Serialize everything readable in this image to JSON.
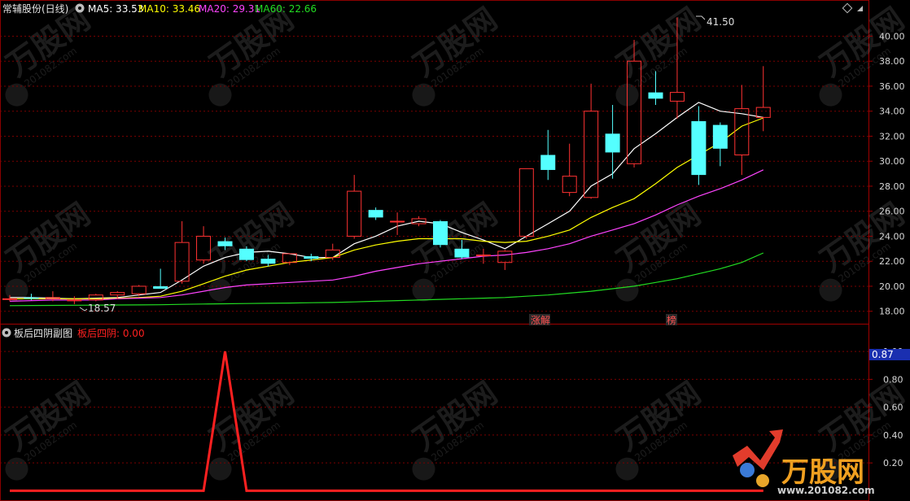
{
  "main_panel": {
    "title": "常辅股份(日线)",
    "ma_labels": [
      {
        "text": "MA5: 33.53",
        "color": "#ffffff"
      },
      {
        "text": "MA10: 33.46",
        "color": "#ffff00"
      },
      {
        "text": "MA20: 29.31",
        "color": "#ff44ff"
      },
      {
        "text": "MA60: 22.66",
        "color": "#22dd22"
      }
    ],
    "annotations": {
      "high": "41.50",
      "low": "18.57"
    },
    "markers": [
      "涨解",
      "榜"
    ],
    "gear_icon": "gear-icon",
    "diamond_icon": "diamond-icon"
  },
  "sub_panel": {
    "title": "板后四阴副图",
    "indicator_label": "板后四阴: 0.00",
    "indicator_color": "#ff2020",
    "current_value_badge": "0.87"
  },
  "watermark": {
    "brand": "万股网",
    "site": "www.201082.com"
  },
  "chart_data": [
    {
      "type": "candlestick",
      "title": "常辅股份(日线)",
      "y_ticks": [
        18.0,
        20.0,
        22.0,
        24.0,
        26.0,
        28.0,
        30.0,
        32.0,
        34.0,
        36.0,
        38.0,
        40.0
      ],
      "ylim": [
        17.2,
        42.5
      ],
      "candles": [
        {
          "o": 19.0,
          "h": 19.3,
          "l": 18.8,
          "c": 19.0
        },
        {
          "o": 19.1,
          "h": 19.4,
          "l": 18.9,
          "c": 19.0
        },
        {
          "o": 19.0,
          "h": 19.6,
          "l": 18.8,
          "c": 19.1
        },
        {
          "o": 18.9,
          "h": 19.2,
          "l": 18.57,
          "c": 18.9
        },
        {
          "o": 18.9,
          "h": 19.4,
          "l": 18.8,
          "c": 19.3
        },
        {
          "o": 19.3,
          "h": 19.6,
          "l": 19.0,
          "c": 19.5
        },
        {
          "o": 19.4,
          "h": 20.1,
          "l": 19.2,
          "c": 20.0
        },
        {
          "o": 20.0,
          "h": 21.4,
          "l": 19.8,
          "c": 19.8
        },
        {
          "o": 20.4,
          "h": 25.2,
          "l": 20.2,
          "c": 23.5
        },
        {
          "o": 22.1,
          "h": 24.8,
          "l": 21.8,
          "c": 24.0
        },
        {
          "o": 23.6,
          "h": 23.9,
          "l": 22.9,
          "c": 23.2
        },
        {
          "o": 23.0,
          "h": 23.2,
          "l": 22.0,
          "c": 22.1
        },
        {
          "o": 22.2,
          "h": 22.5,
          "l": 21.6,
          "c": 21.8
        },
        {
          "o": 21.9,
          "h": 22.6,
          "l": 21.7,
          "c": 22.6
        },
        {
          "o": 22.4,
          "h": 22.6,
          "l": 22.0,
          "c": 22.2
        },
        {
          "o": 22.3,
          "h": 23.4,
          "l": 22.1,
          "c": 22.9
        },
        {
          "o": 24.0,
          "h": 28.9,
          "l": 23.8,
          "c": 27.6
        },
        {
          "o": 26.1,
          "h": 26.3,
          "l": 25.3,
          "c": 25.5
        },
        {
          "o": 25.2,
          "h": 25.9,
          "l": 24.1,
          "c": 25.2
        },
        {
          "o": 25.0,
          "h": 25.6,
          "l": 24.8,
          "c": 25.4
        },
        {
          "o": 25.2,
          "h": 25.3,
          "l": 23.1,
          "c": 23.3
        },
        {
          "o": 23.0,
          "h": 23.7,
          "l": 22.2,
          "c": 22.3
        },
        {
          "o": 22.5,
          "h": 23.0,
          "l": 21.8,
          "c": 22.5
        },
        {
          "o": 21.9,
          "h": 22.9,
          "l": 21.3,
          "c": 22.8
        },
        {
          "o": 24.0,
          "h": 29.4,
          "l": 23.8,
          "c": 29.4
        },
        {
          "o": 30.5,
          "h": 32.5,
          "l": 28.5,
          "c": 29.3
        },
        {
          "o": 27.5,
          "h": 31.4,
          "l": 27.2,
          "c": 28.8
        },
        {
          "o": 27.1,
          "h": 36.2,
          "l": 27.0,
          "c": 34.0
        },
        {
          "o": 32.2,
          "h": 34.5,
          "l": 28.6,
          "c": 30.7
        },
        {
          "o": 29.8,
          "h": 39.7,
          "l": 29.5,
          "c": 38.0
        },
        {
          "o": 35.5,
          "h": 37.2,
          "l": 34.5,
          "c": 35.0
        },
        {
          "o": 34.8,
          "h": 41.5,
          "l": 33.4,
          "c": 35.5
        },
        {
          "o": 33.2,
          "h": 34.4,
          "l": 28.1,
          "c": 28.9
        },
        {
          "o": 32.9,
          "h": 33.1,
          "l": 29.6,
          "c": 31.0
        },
        {
          "o": 30.5,
          "h": 36.1,
          "l": 28.9,
          "c": 34.2
        },
        {
          "o": 33.5,
          "h": 37.6,
          "l": 32.4,
          "c": 34.3
        }
      ],
      "ma_series": [
        {
          "name": "MA5",
          "color": "#ffffff",
          "start": 0,
          "values": [
            19.1,
            19.1,
            19.05,
            19.0,
            19.05,
            19.1,
            19.3,
            19.5,
            20.5,
            21.6,
            22.3,
            22.7,
            22.8,
            22.6,
            22.3,
            22.3,
            23.4,
            24.0,
            24.8,
            25.2,
            25.0,
            24.3,
            23.7,
            23.0,
            24.0,
            25.0,
            26.0,
            28.0,
            29.0,
            31.0,
            32.2,
            33.5,
            34.7,
            34.0,
            33.8,
            33.5
          ]
        },
        {
          "name": "MA10",
          "color": "#ffff00",
          "start": 0,
          "values": [
            19.0,
            19.0,
            19.0,
            19.0,
            19.0,
            19.05,
            19.1,
            19.2,
            19.6,
            20.2,
            20.8,
            21.3,
            21.6,
            21.9,
            22.1,
            22.3,
            22.9,
            23.3,
            23.6,
            23.8,
            23.8,
            23.8,
            23.6,
            23.5,
            23.6,
            24.0,
            24.5,
            25.5,
            26.3,
            27.0,
            28.2,
            29.5,
            30.5,
            31.5,
            32.8,
            33.46
          ]
        },
        {
          "name": "MA20",
          "color": "#ff44ff",
          "start": 0,
          "values": [
            18.8,
            18.85,
            18.9,
            18.9,
            18.9,
            19.0,
            19.05,
            19.1,
            19.3,
            19.6,
            19.9,
            20.1,
            20.2,
            20.3,
            20.4,
            20.5,
            20.8,
            21.2,
            21.5,
            21.8,
            22.0,
            22.2,
            22.4,
            22.5,
            22.7,
            23.0,
            23.4,
            24.0,
            24.5,
            25.0,
            25.7,
            26.5,
            27.2,
            27.8,
            28.5,
            29.31
          ]
        },
        {
          "name": "MA60",
          "color": "#22dd22",
          "start": 0,
          "values": [
            18.45,
            18.46,
            18.47,
            18.48,
            18.49,
            18.5,
            18.51,
            18.52,
            18.55,
            18.58,
            18.6,
            18.62,
            18.64,
            18.66,
            18.68,
            18.7,
            18.75,
            18.8,
            18.85,
            18.9,
            18.95,
            19.0,
            19.05,
            19.1,
            19.2,
            19.3,
            19.45,
            19.6,
            19.8,
            20.0,
            20.3,
            20.6,
            21.0,
            21.4,
            21.9,
            22.66
          ]
        }
      ]
    },
    {
      "type": "line",
      "title": "板后四阴副图",
      "y_ticks": [
        0.2,
        0.4,
        0.6,
        0.8,
        1.0
      ],
      "ylim": [
        -0.05,
        1.1
      ],
      "series": [
        {
          "name": "板后四阴",
          "color": "#ff2020",
          "values": [
            0,
            0,
            0,
            0,
            0,
            0,
            0,
            0,
            0,
            0,
            1,
            0,
            0,
            0,
            0,
            0,
            0,
            0,
            0,
            0,
            0,
            0,
            0,
            0,
            0,
            0,
            0,
            0,
            0,
            0,
            0,
            0,
            0,
            0,
            0,
            0
          ]
        }
      ]
    }
  ]
}
